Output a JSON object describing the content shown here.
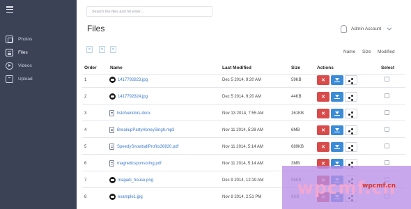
{
  "sidebar": {
    "items": [
      {
        "label": "Photos",
        "icon": "photo-icon"
      },
      {
        "label": "Files",
        "icon": "file-icon",
        "active": true
      },
      {
        "label": "Videos",
        "icon": "video-icon"
      },
      {
        "label": "Upload",
        "icon": "upload-icon"
      }
    ]
  },
  "search": {
    "placeholder": "Search the files and hit enter..."
  },
  "page": {
    "title": "Files"
  },
  "account": {
    "label": "Admin Account"
  },
  "sort": {
    "name": "Name",
    "size": "Size",
    "modified": "Modified"
  },
  "table": {
    "headers": {
      "order": "Order",
      "name": "Name",
      "modified": "Last Modified",
      "size": "Size",
      "actions": "Actions",
      "select": "Select"
    },
    "rows": [
      {
        "order": "1",
        "name": "1417792823.jpg",
        "type": "image",
        "modified": "Dec 5 2014, 9:20 AM",
        "size": "59KB"
      },
      {
        "order": "2",
        "name": "1417792824.jpg",
        "type": "image",
        "modified": "Dec 5 2014, 9:20 AM",
        "size": "44KB"
      },
      {
        "order": "3",
        "name": "listofvendors.docx",
        "type": "document",
        "modified": "Nov 13 2014, 7:55 AM",
        "size": "161KB"
      },
      {
        "order": "4",
        "name": "BreakupPartyHoneySingh.mp3",
        "type": "document",
        "modified": "Nov 11 2014, 5:28 AM",
        "size": "6MB"
      },
      {
        "order": "5",
        "name": "SpeedySnowballProfits36820.pdf",
        "type": "document",
        "modified": "Nov 11 2014, 5:14 AM",
        "size": "689KB"
      },
      {
        "order": "6",
        "name": "magneticsponsoring.pdf",
        "type": "document",
        "modified": "Nov 11 2014, 5:14 AM",
        "size": "3MB"
      },
      {
        "order": "7",
        "name": "magadi_house.png",
        "type": "image",
        "modified": "Dec 9 2014, 12:19 AM",
        "size": "96KB"
      },
      {
        "order": "8",
        "name": "example1.jpg",
        "type": "image",
        "modified": "Nov 8 2014, 2:51 PM",
        "size": "9KB"
      }
    ],
    "delete_glyph": "✕"
  },
  "watermark": {
    "text": "wpcmf.cn",
    "small_text": "wpcmf.cn"
  },
  "colors": {
    "sidebar": "#3b4256",
    "delete": "#d94b4b",
    "download": "#3b8cd8",
    "link": "#3a78c9"
  }
}
